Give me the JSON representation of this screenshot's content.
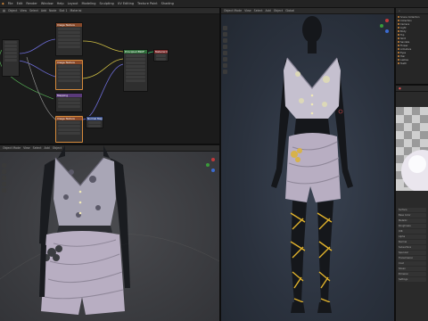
{
  "app": {
    "title": "Blender"
  },
  "topbar": {
    "items": [
      "File",
      "Edit",
      "Render",
      "Window",
      "Help",
      "Layout",
      "Modeling",
      "Sculpting",
      "UV Editing",
      "Texture Paint",
      "Shading"
    ]
  },
  "node_editor": {
    "header_items": [
      "Object",
      "View",
      "Select",
      "Add",
      "Node",
      "Slot 1",
      "Material"
    ],
    "nodes": [
      {
        "title": "Image Texture",
        "color": "#8a4a2a"
      },
      {
        "title": "Image Texture",
        "color": "#8a4a2a"
      },
      {
        "title": "Mapping",
        "color": "#5a3a7a"
      },
      {
        "title": "Principled BSDF",
        "color": "#2f6e3a"
      },
      {
        "title": "Material Output",
        "color": "#7a2a2a"
      },
      {
        "title": "Normal Map",
        "color": "#3a4f8a"
      },
      {
        "title": "Image Texture",
        "color": "#8a4a2a"
      }
    ]
  },
  "viewport_left": {
    "header_items": [
      "Object Mode",
      "View",
      "Select",
      "Add",
      "Object"
    ]
  },
  "viewport_main": {
    "header_items": [
      "Object Mode",
      "View",
      "Select",
      "Add",
      "Object",
      "Global"
    ]
  },
  "outliner": {
    "items": [
      "Scene Collection",
      "Collection",
      "Camera",
      "Light",
      "Body",
      "Top",
      "Skirt",
      "Sandals",
      "Flower",
      "Armature",
      "Eyes",
      "Hair",
      "Lashes",
      "Teeth"
    ]
  },
  "properties": {
    "rows": [
      "Surface",
      "Base Color",
      "Metallic",
      "Roughness",
      "IOR",
      "Alpha",
      "Normal",
      "Subsurface",
      "Specular",
      "Transmission",
      "Coat",
      "Sheen",
      "Emission",
      "Settings"
    ]
  },
  "colors": {
    "accent": "#d58a3b",
    "panel": "#2b2b2b",
    "background": "#1d1d1d",
    "fabric": "#b8aec2",
    "strap": "#e2b32c"
  }
}
